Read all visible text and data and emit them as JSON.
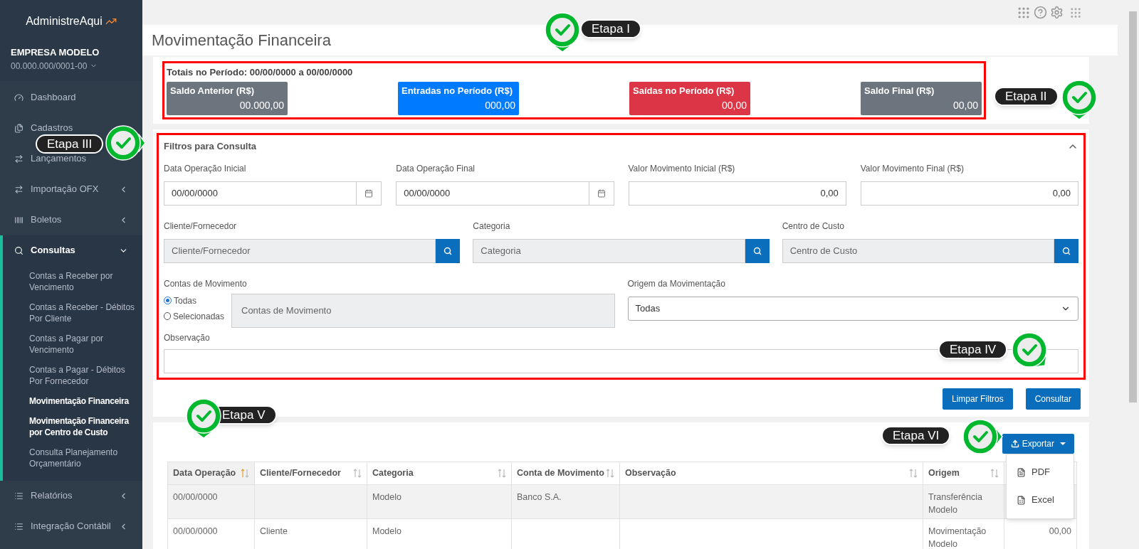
{
  "brand": {
    "name": "AdministreAqui"
  },
  "company": {
    "name": "EMPRESA MODELO",
    "document": "00.000.000/0001-00"
  },
  "sidebar": {
    "items": [
      {
        "label": "Dashboard",
        "kind": "link",
        "expanded": false
      },
      {
        "label": "Cadastros",
        "kind": "link",
        "expanded": false
      },
      {
        "label": "Lançamentos",
        "kind": "link",
        "expanded": false
      },
      {
        "label": "Importação OFX",
        "kind": "group",
        "expanded": false
      },
      {
        "label": "Boletos",
        "kind": "group",
        "expanded": false
      },
      {
        "label": "Consultas",
        "kind": "group",
        "expanded": true,
        "children": [
          {
            "label": "Contas a Receber por Vencimento",
            "selected": false
          },
          {
            "label": "Contas a Receber - Débitos Por Cliente",
            "selected": false
          },
          {
            "label": "Contas a Pagar por Vencimento",
            "selected": false
          },
          {
            "label": "Contas a Pagar - Débitos Por Fornecedor",
            "selected": false
          },
          {
            "label": "Movimentação Financeira",
            "selected": true
          },
          {
            "label": "Movimentação Financeira por Centro de Custo",
            "selected": true
          },
          {
            "label": "Consulta Planejamento Orçamentário",
            "selected": false
          }
        ]
      },
      {
        "label": "Relatórios",
        "kind": "group",
        "expanded": false
      },
      {
        "label": "Integração Contábil",
        "kind": "group",
        "expanded": false
      }
    ]
  },
  "page": {
    "title": "Movimentação Financeira"
  },
  "totals": {
    "title": "Totais no Período: 00/00/0000 a 00/00/0000",
    "cards": [
      {
        "label": "Saldo Anterior (R$)",
        "value": "00.000,00",
        "color": "#6c757d"
      },
      {
        "label": "Entradas no Período (R$)",
        "value": "000,00",
        "color": "#007bff"
      },
      {
        "label": "Saídas no Período (R$)",
        "value": "00,00",
        "color": "#dc3545"
      },
      {
        "label": "Saldo Final (R$)",
        "value": "00,00",
        "color": "#6c757d"
      }
    ]
  },
  "filters": {
    "title": "Filtros para Consulta",
    "expanded": true,
    "date_fields": [
      {
        "label": "Data Operação Inicial",
        "value": "00/00/0000",
        "kind": "date"
      },
      {
        "label": "Data Operação Final",
        "value": "00/00/0000",
        "kind": "date"
      },
      {
        "label": "Valor Movimento Inicial (R$)",
        "value": "0,00",
        "kind": "amount"
      },
      {
        "label": "Valor Movimento Final (R$)",
        "value": "0,00",
        "kind": "amount"
      }
    ],
    "lookup_fields": [
      {
        "label": "Cliente/Fornecedor",
        "placeholder": "Cliente/Fornecedor"
      },
      {
        "label": "Categoria",
        "placeholder": "Categoria"
      },
      {
        "label": "Centro de Custo",
        "placeholder": "Centro de Custo"
      }
    ],
    "accounts": {
      "label": "Contas de Movimento",
      "options": [
        {
          "label": "Todas",
          "selected": true
        },
        {
          "label": "Selecionadas",
          "selected": false
        }
      ],
      "placeholder": "Contas de Movimento"
    },
    "origin": {
      "label": "Origem da Movimentação",
      "value": "Todas"
    },
    "note": {
      "label": "Observação"
    },
    "buttons": [
      "Limpar Filtros",
      "Consultar"
    ]
  },
  "export": {
    "label": "Exportar",
    "expanded": true,
    "items": [
      "PDF",
      "Excel"
    ]
  },
  "table": {
    "columns": [
      {
        "label": "Data Operação",
        "sorted": true
      },
      {
        "label": "Cliente/Fornecedor",
        "sorted": false
      },
      {
        "label": "Categoria",
        "sorted": false
      },
      {
        "label": "Conta de Movimento",
        "sorted": false
      },
      {
        "label": "Observação",
        "sorted": false
      },
      {
        "label": "Origem",
        "sorted": false
      }
    ],
    "rows": [
      {
        "highlighted": true,
        "cells": [
          "00/00/0000",
          null,
          "Modelo",
          "Banco S.A.",
          null,
          "Transferência Modelo"
        ]
      },
      {
        "highlighted": false,
        "cells": [
          "00/00/0000",
          "Cliente",
          "Modelo",
          null,
          null,
          "Movimentação Modelo"
        ],
        "column_7": "00,00"
      }
    ]
  },
  "annotations": [
    {
      "label": "Etapa I"
    },
    {
      "label": "Etapa II"
    },
    {
      "label": "Etapa III"
    },
    {
      "label": "Etapa IV"
    },
    {
      "label": "Etapa V"
    },
    {
      "label": "Etapa VI"
    }
  ]
}
